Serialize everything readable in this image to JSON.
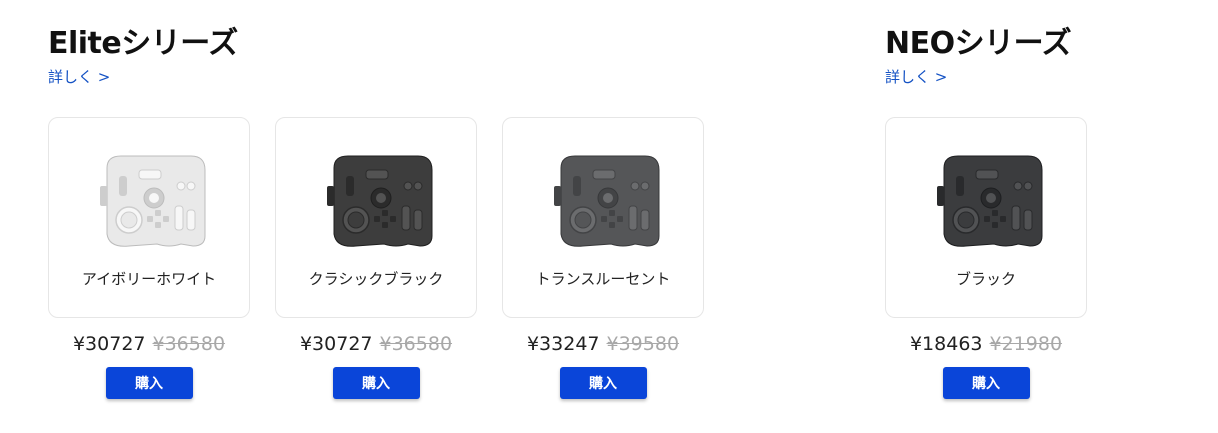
{
  "elite": {
    "title": "Eliteシリーズ",
    "details_link": "詳しく >",
    "products": [
      {
        "name": "アイボリーホワイト",
        "price": "¥30727",
        "original_price": "¥36580",
        "buy_label": "購入",
        "device_color": "#e9e9e9"
      },
      {
        "name": "クラシックブラック",
        "price": "¥30727",
        "original_price": "¥36580",
        "buy_label": "購入",
        "device_color": "#3d3d3d"
      },
      {
        "name": "トランスルーセント",
        "price": "¥33247",
        "original_price": "¥39580",
        "buy_label": "購入",
        "device_color": "#555658"
      }
    ]
  },
  "neo": {
    "title": "NEOシリーズ",
    "details_link": "詳しく >",
    "products": [
      {
        "name": "ブラック",
        "price": "¥18463",
        "original_price": "¥21980",
        "buy_label": "購入",
        "device_color": "#3b3c3e"
      }
    ]
  },
  "colors": {
    "accent": "#0a45d9",
    "link": "#1452c4",
    "strike_price": "#a8a8a8"
  }
}
